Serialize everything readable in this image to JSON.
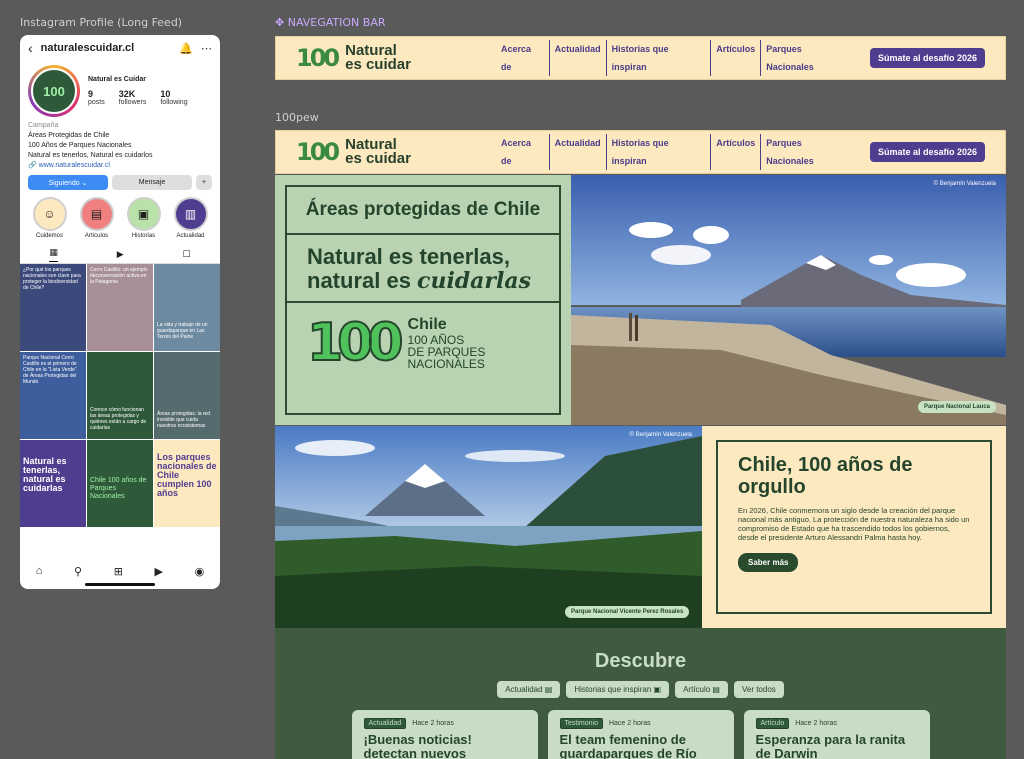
{
  "canvas": {
    "frame1_label": "Instagram Profile (Long Feed)",
    "frame2_label": "✥ NAVEGATION BAR",
    "frame3_label": "100pew"
  },
  "instagram": {
    "username": "naturalescuidar.cl",
    "display_name": "Natural es Cuidar",
    "avatar_text": "100",
    "posts": "9",
    "posts_label": "posts",
    "followers": "32K",
    "followers_label": "followers",
    "following": "10",
    "following_label": "following",
    "category": "Campaña",
    "bio1": "Áreas Protegidas de Chile",
    "bio2": "100 Años de Parques Nacionales",
    "bio3": "Natural es tenerlos, Natural es cuidarlos",
    "link": "www.naturalescuidar.cl",
    "follow_btn": "Siguiendo ⌄",
    "message_btn": "Mensaje",
    "highlights": [
      {
        "label": "Cuidemos",
        "color": "#fde9c0"
      },
      {
        "label": "Artículos",
        "color": "#f08080"
      },
      {
        "label": "Historias",
        "color": "#b8e2a8"
      },
      {
        "label": "Actualidad",
        "color": "#4f3d8f"
      }
    ],
    "posts_grid": [
      {
        "text": "¿Por qué los parques nacionales son clave para proteger la biodiversidad de Chile?",
        "bg": "#3b4a7a"
      },
      {
        "text": "Cerro Castillo: un ejemplo deconservación activa en la Patagonia",
        "bg": "#a78f9a"
      },
      {
        "text": "La vida y trabajo de un guardaparque en Las Torres del Paine",
        "bg": "#6d8aa0"
      },
      {
        "text": "Parque Nacional Cerro Castillo es el primero de Chile en la \"Lista Verde\" de Áreas Protegidas del Mundo",
        "bg": "#3e5d9c"
      },
      {
        "text": "Conoce cómo funcionan las áreas protegidas y quiénes están a cargo de cuidarlas",
        "bg": "#2f5a3a"
      },
      {
        "text": "Áreas protegidas: la red invisible que cuida nuestros ecosistemas",
        "bg": "#556b6f"
      },
      {
        "text": "Natural es tenerlas, natural es cuidarlas",
        "bg": "#4f3d8f"
      },
      {
        "text": "Chile 100 años de Parques Nacionales",
        "bg": "#2f5a3a"
      },
      {
        "text": "Los parques nacionales de Chile cumplen 100 años",
        "bg": "#fde9c0"
      }
    ]
  },
  "nav": {
    "logo_mark": "100",
    "logo_line1": "Natural",
    "logo_line2": "es cuidar",
    "links": [
      "Acerca de",
      "Actualidad",
      "Historias que inspiran",
      "Artículos",
      "Parques Nacionales"
    ],
    "cta": "Súmate al desafío 2026"
  },
  "hero": {
    "row1": "Áreas protegidas de Chile",
    "row2a": "Natural es tenerlas,",
    "row2b": "natural es ",
    "row2c": "cuidarlas",
    "big": "100",
    "chile": "Chile",
    "sub1": "100 AÑOS",
    "sub2": "DE PARQUES",
    "sub3": "NACIONALES",
    "credit": "© Benjamín Valenzuela",
    "photo1_tag": "Parque Nacional Lauca",
    "photo2_tag": "Parque Nacional Vicente Perez Rosales"
  },
  "orgullo": {
    "title": "Chile, 100 años de orgullo",
    "body": "En 2026, Chile conmemora un siglo desde la creación del parque nacional más antiguo. La protección de nuestra naturaleza ha sido un compromiso de Estado que ha trascendido todos los gobiernos, desde el presidente Arturo Alessandri Palma hasta hoy.",
    "cta": "Saber más"
  },
  "descubre": {
    "title": "Descubre",
    "filters": [
      "Actualidad ▤",
      "Historias que inspiran ▣",
      "Artículo ▤",
      "Ver todos"
    ],
    "cards": [
      {
        "badge": "Actualidad",
        "time": "Hace 2 horas",
        "title": "¡Buenas noticias! detectan nuevos"
      },
      {
        "badge": "Testimonio",
        "time": "Hace 2 horas",
        "title": "El team femenino de guardaparques de Río"
      },
      {
        "badge": "Artículo",
        "time": "Hace 2 horas",
        "title": "Esperanza para la ranita de Darwin"
      }
    ]
  }
}
